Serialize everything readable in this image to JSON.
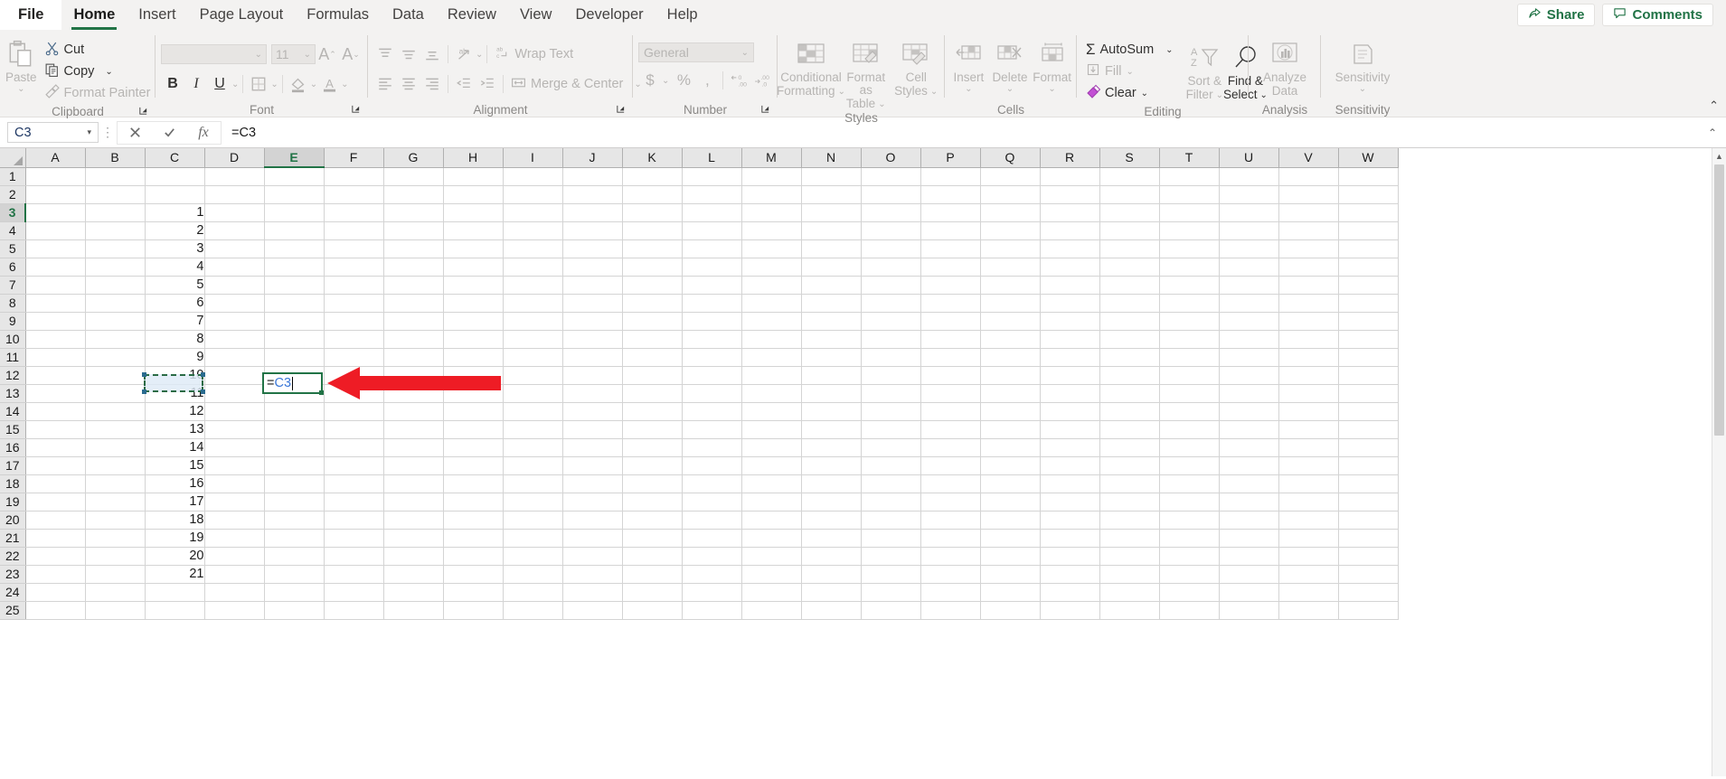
{
  "app": {
    "active_tab": "Home",
    "tabs": [
      {
        "label": "File"
      },
      {
        "label": "Home"
      },
      {
        "label": "Insert"
      },
      {
        "label": "Page Layout"
      },
      {
        "label": "Formulas"
      },
      {
        "label": "Data"
      },
      {
        "label": "Review"
      },
      {
        "label": "View"
      },
      {
        "label": "Developer"
      },
      {
        "label": "Help"
      }
    ],
    "share_label": "Share",
    "comments_label": "Comments",
    "accent_color": "#217346"
  },
  "ribbon": {
    "clipboard": {
      "group_label": "Clipboard",
      "paste_label": "Paste",
      "cut_label": "Cut",
      "copy_label": "Copy",
      "format_painter_label": "Format Painter"
    },
    "font": {
      "group_label": "Font",
      "font_name": "",
      "font_name_placeholder": "",
      "font_size": "11",
      "bold_label": "B",
      "italic_label": "I",
      "underline_label": "U",
      "grow_font_label": "A",
      "shrink_font_label": "A"
    },
    "alignment": {
      "group_label": "Alignment",
      "wrap_text_label": "Wrap Text",
      "merge_center_label": "Merge & Center"
    },
    "number": {
      "group_label": "Number",
      "format_value": "General",
      "currency_label": "$",
      "percent_label": "%",
      "comma_label": ",",
      "increase_decimal_label": ".00",
      "decrease_decimal_label": ".00"
    },
    "styles": {
      "group_label": "Styles",
      "conditional_formatting_label": "Conditional\nFormatting",
      "conditional_formatting_l1": "Conditional",
      "conditional_formatting_l2": "Formatting",
      "format_as_table_l1": "Format as",
      "format_as_table_l2": "Table",
      "cell_styles_l1": "Cell",
      "cell_styles_l2": "Styles"
    },
    "cells": {
      "group_label": "Cells",
      "insert_label": "Insert",
      "delete_label": "Delete",
      "format_label": "Format"
    },
    "editing": {
      "group_label": "Editing",
      "autosum_label": "AutoSum",
      "fill_label": "Fill",
      "clear_label": "Clear",
      "sort_filter_l1": "Sort &",
      "sort_filter_l2": "Filter",
      "find_select_l1": "Find &",
      "find_select_l2": "Select"
    },
    "analysis": {
      "group_label": "Analysis",
      "analyze_data_l1": "Analyze",
      "analyze_data_l2": "Data"
    },
    "sensitivity": {
      "group_label": "Sensitivity",
      "sensitivity_label": "Sensitivity"
    }
  },
  "formula_bar": {
    "name_box_value": "C3",
    "cancel_icon": "cancel-icon",
    "enter_icon": "enter-icon",
    "function_icon": "fx",
    "formula_value": "=C3",
    "expand_icon": "chevron-down-icon"
  },
  "sheet": {
    "columns": [
      "A",
      "B",
      "C",
      "D",
      "E",
      "F",
      "G",
      "H",
      "I",
      "J",
      "K",
      "L",
      "M",
      "N",
      "O",
      "P",
      "Q",
      "R",
      "S",
      "T",
      "U",
      "V",
      "W"
    ],
    "selected_column": "E",
    "rows": [
      "1",
      "2",
      "3",
      "4",
      "5",
      "6",
      "7",
      "8",
      "9",
      "10",
      "11",
      "12",
      "13",
      "14",
      "15",
      "16",
      "17",
      "18",
      "19",
      "20",
      "21",
      "22",
      "23",
      "24",
      "25"
    ],
    "selected_row": "3",
    "column_c_values": [
      {
        "row": "3",
        "value": "1"
      },
      {
        "row": "4",
        "value": "2"
      },
      {
        "row": "5",
        "value": "3"
      },
      {
        "row": "6",
        "value": "4"
      },
      {
        "row": "7",
        "value": "5"
      },
      {
        "row": "8",
        "value": "6"
      },
      {
        "row": "9",
        "value": "7"
      },
      {
        "row": "10",
        "value": "8"
      },
      {
        "row": "11",
        "value": "9"
      },
      {
        "row": "12",
        "value": "10"
      },
      {
        "row": "13",
        "value": "11"
      },
      {
        "row": "14",
        "value": "12"
      },
      {
        "row": "15",
        "value": "13"
      },
      {
        "row": "16",
        "value": "14"
      },
      {
        "row": "17",
        "value": "15"
      },
      {
        "row": "18",
        "value": "16"
      },
      {
        "row": "19",
        "value": "17"
      },
      {
        "row": "20",
        "value": "18"
      },
      {
        "row": "21",
        "value": "19"
      },
      {
        "row": "22",
        "value": "20"
      },
      {
        "row": "23",
        "value": "21"
      }
    ],
    "reference_cell": {
      "ref": "C3",
      "value": "1"
    },
    "editing_cell": {
      "ref": "E3",
      "equals": "=",
      "reference": "C3"
    },
    "annotation": {
      "type": "red-arrow",
      "points_to": "E3",
      "color": "#ee1c25"
    }
  }
}
